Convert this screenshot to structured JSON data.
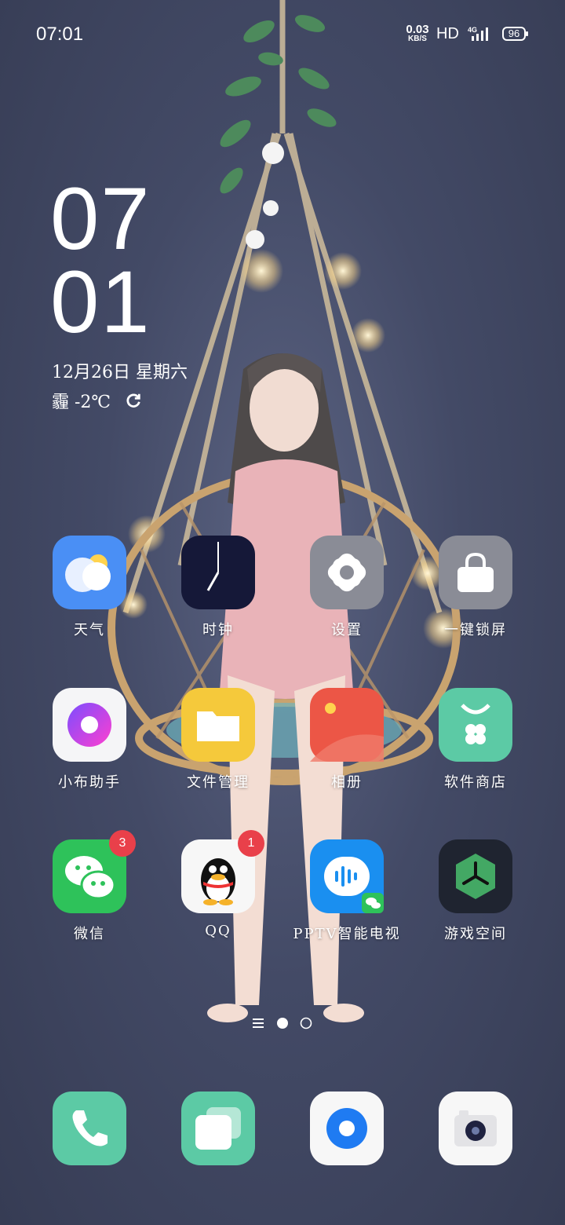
{
  "status_bar": {
    "time": "07:01",
    "net_speed_value": "0.03",
    "net_speed_unit": "KB/S",
    "hd": "HD",
    "network": "4G",
    "battery": "96"
  },
  "clock_widget": {
    "hour": "07",
    "minute": "01",
    "date": "12月26日 星期六",
    "weather": "霾 -2℃"
  },
  "apps": [
    {
      "label": "天气",
      "icon": "weather-icon"
    },
    {
      "label": "时钟",
      "icon": "clock-icon"
    },
    {
      "label": "设置",
      "icon": "settings-icon"
    },
    {
      "label": "一键锁屏",
      "icon": "lock-icon"
    },
    {
      "label": "小布助手",
      "icon": "assistant-icon"
    },
    {
      "label": "文件管理",
      "icon": "folder-icon"
    },
    {
      "label": "相册",
      "icon": "gallery-icon"
    },
    {
      "label": "软件商店",
      "icon": "app-store-icon"
    },
    {
      "label": "微信",
      "icon": "wechat-icon",
      "badge": "3"
    },
    {
      "label": "QQ",
      "icon": "qq-icon",
      "badge": "1"
    },
    {
      "label": "PPTV智能电视",
      "icon": "pptv-icon"
    },
    {
      "label": "游戏空间",
      "icon": "game-space-icon"
    }
  ],
  "dock": [
    {
      "icon": "phone-icon"
    },
    {
      "icon": "messages-icon"
    },
    {
      "icon": "browser-icon"
    },
    {
      "icon": "camera-icon"
    }
  ],
  "page_indicator": {
    "pages": 2,
    "current": 1
  },
  "colors": {
    "wallpaper": "#434a66",
    "badge": "#e9404a",
    "accent_green": "#5ccaa5"
  }
}
